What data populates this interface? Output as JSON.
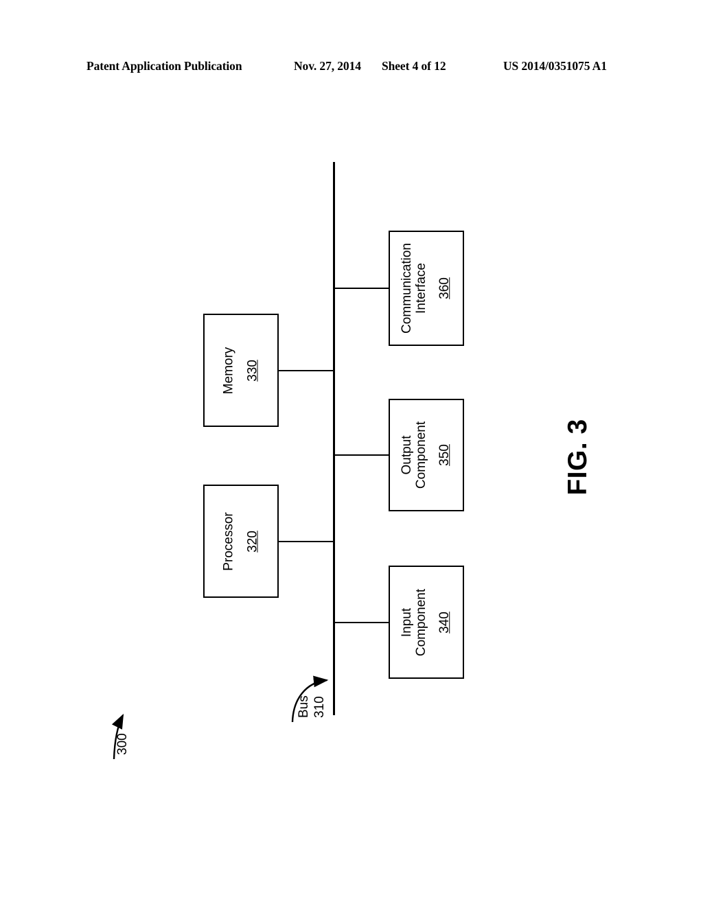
{
  "header": {
    "publication": "Patent Application Publication",
    "date": "Nov. 27, 2014",
    "sheet": "Sheet 4 of 12",
    "patent_number": "US 2014/0351075 A1"
  },
  "figure": {
    "label": "FIG. 3",
    "system_reference": "300",
    "orientation": "landscape-rotated-90ccw",
    "line_color": "#000000",
    "background_color": "#ffffff"
  },
  "diagram": {
    "type": "block-diagram",
    "bus": {
      "name": "Bus",
      "reference": "310"
    },
    "nodes": [
      {
        "id": "memory",
        "label": "Memory",
        "reference": "330",
        "side": "upper",
        "connects_to": "bus"
      },
      {
        "id": "processor",
        "label": "Processor",
        "reference": "320",
        "side": "upper",
        "connects_to": "bus"
      },
      {
        "id": "communication-interface",
        "label_line1": "Communication",
        "label_line2": "Interface",
        "reference": "360",
        "side": "lower",
        "connects_to": "bus"
      },
      {
        "id": "output-component",
        "label_line1": "Output",
        "label_line2": "Component",
        "reference": "350",
        "side": "lower",
        "connects_to": "bus"
      },
      {
        "id": "input-component",
        "label_line1": "Input",
        "label_line2": "Component",
        "reference": "340",
        "side": "lower",
        "connects_to": "bus"
      }
    ]
  }
}
